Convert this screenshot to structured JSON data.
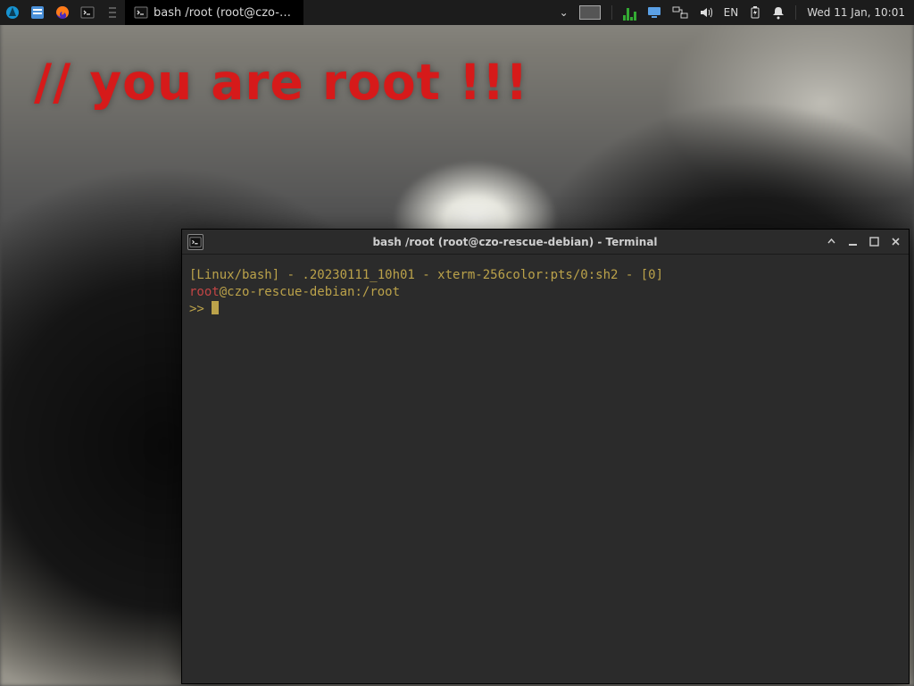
{
  "panel": {
    "taskbar": {
      "active_title": "bash /root (root@czo-re...",
      "dropdown_glyph": "⌄"
    },
    "tray": {
      "language": "EN",
      "clock": "Wed 11 Jan, 10:01"
    }
  },
  "desktop": {
    "warning_text": "// you are root !!!"
  },
  "terminal": {
    "title": "bash /root (root@czo-rescue-debian) - Terminal",
    "line1": "[Linux/bash] - .20230111_10h01 - xterm-256color:pts/0:sh2 - [0]",
    "prompt_user": "root",
    "prompt_at": "@",
    "prompt_host": "czo-rescue-debian",
    "prompt_colon": ":",
    "prompt_path": "/root",
    "ps2": ">> "
  }
}
